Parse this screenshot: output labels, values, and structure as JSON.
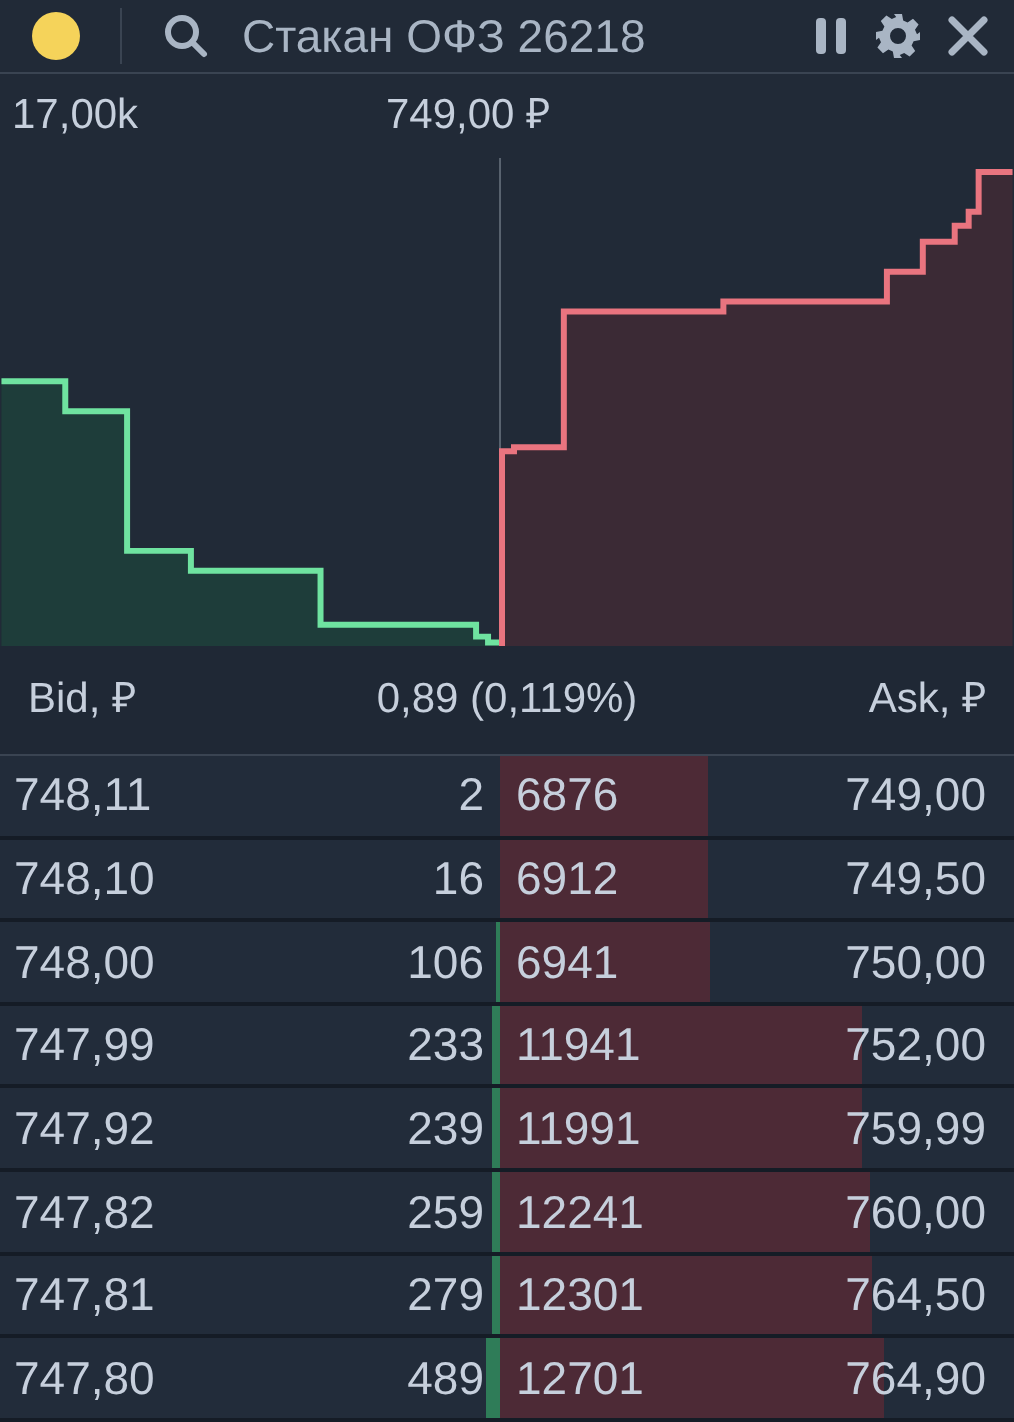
{
  "window": {
    "title": "Стакан ОФЗ 26218"
  },
  "chart_labels": {
    "max_volume": "17,00k",
    "mid_price": "749,00 ₽"
  },
  "table": {
    "columns": [
      "Bid, ₽",
      "0,89 (0,119%)",
      "Ask, ₽"
    ],
    "rows": [
      {
        "bid_price": "748,11",
        "bid_volume": "2",
        "ask_volume": "6876",
        "ask_price": "749,00"
      },
      {
        "bid_price": "748,10",
        "bid_volume": "16",
        "ask_volume": "6912",
        "ask_price": "749,50"
      },
      {
        "bid_price": "748,00",
        "bid_volume": "106",
        "ask_volume": "6941",
        "ask_price": "750,00"
      },
      {
        "bid_price": "747,99",
        "bid_volume": "233",
        "ask_volume": "11941",
        "ask_price": "752,00"
      },
      {
        "bid_price": "747,92",
        "bid_volume": "239",
        "ask_volume": "11991",
        "ask_price": "759,99"
      },
      {
        "bid_price": "747,82",
        "bid_volume": "259",
        "ask_volume": "12241",
        "ask_price": "760,00"
      },
      {
        "bid_price": "747,81",
        "bid_volume": "279",
        "ask_volume": "12301",
        "ask_price": "764,50"
      },
      {
        "bid_price": "747,80",
        "bid_volume": "489",
        "ask_volume": "12701",
        "ask_price": "764,90"
      }
    ]
  }
}
